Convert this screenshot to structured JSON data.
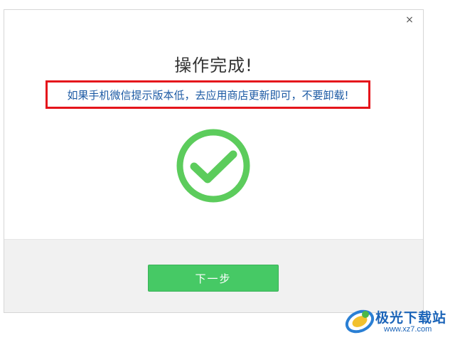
{
  "dialog": {
    "close_glyph": "×",
    "title": "操作完成!",
    "notice": "如果手机微信提示版本低，去应用商店更新即可，不要卸载!",
    "status_icon": "check-circle-icon",
    "next_button_label": "下一步"
  },
  "watermark": {
    "name": "极光下载站",
    "url": "www.xz7.com"
  },
  "colors": {
    "success_green": "#5ccc5c",
    "button_green": "#46c965",
    "notice_blue": "#1c5aa4",
    "highlight_red": "#e5141b"
  }
}
